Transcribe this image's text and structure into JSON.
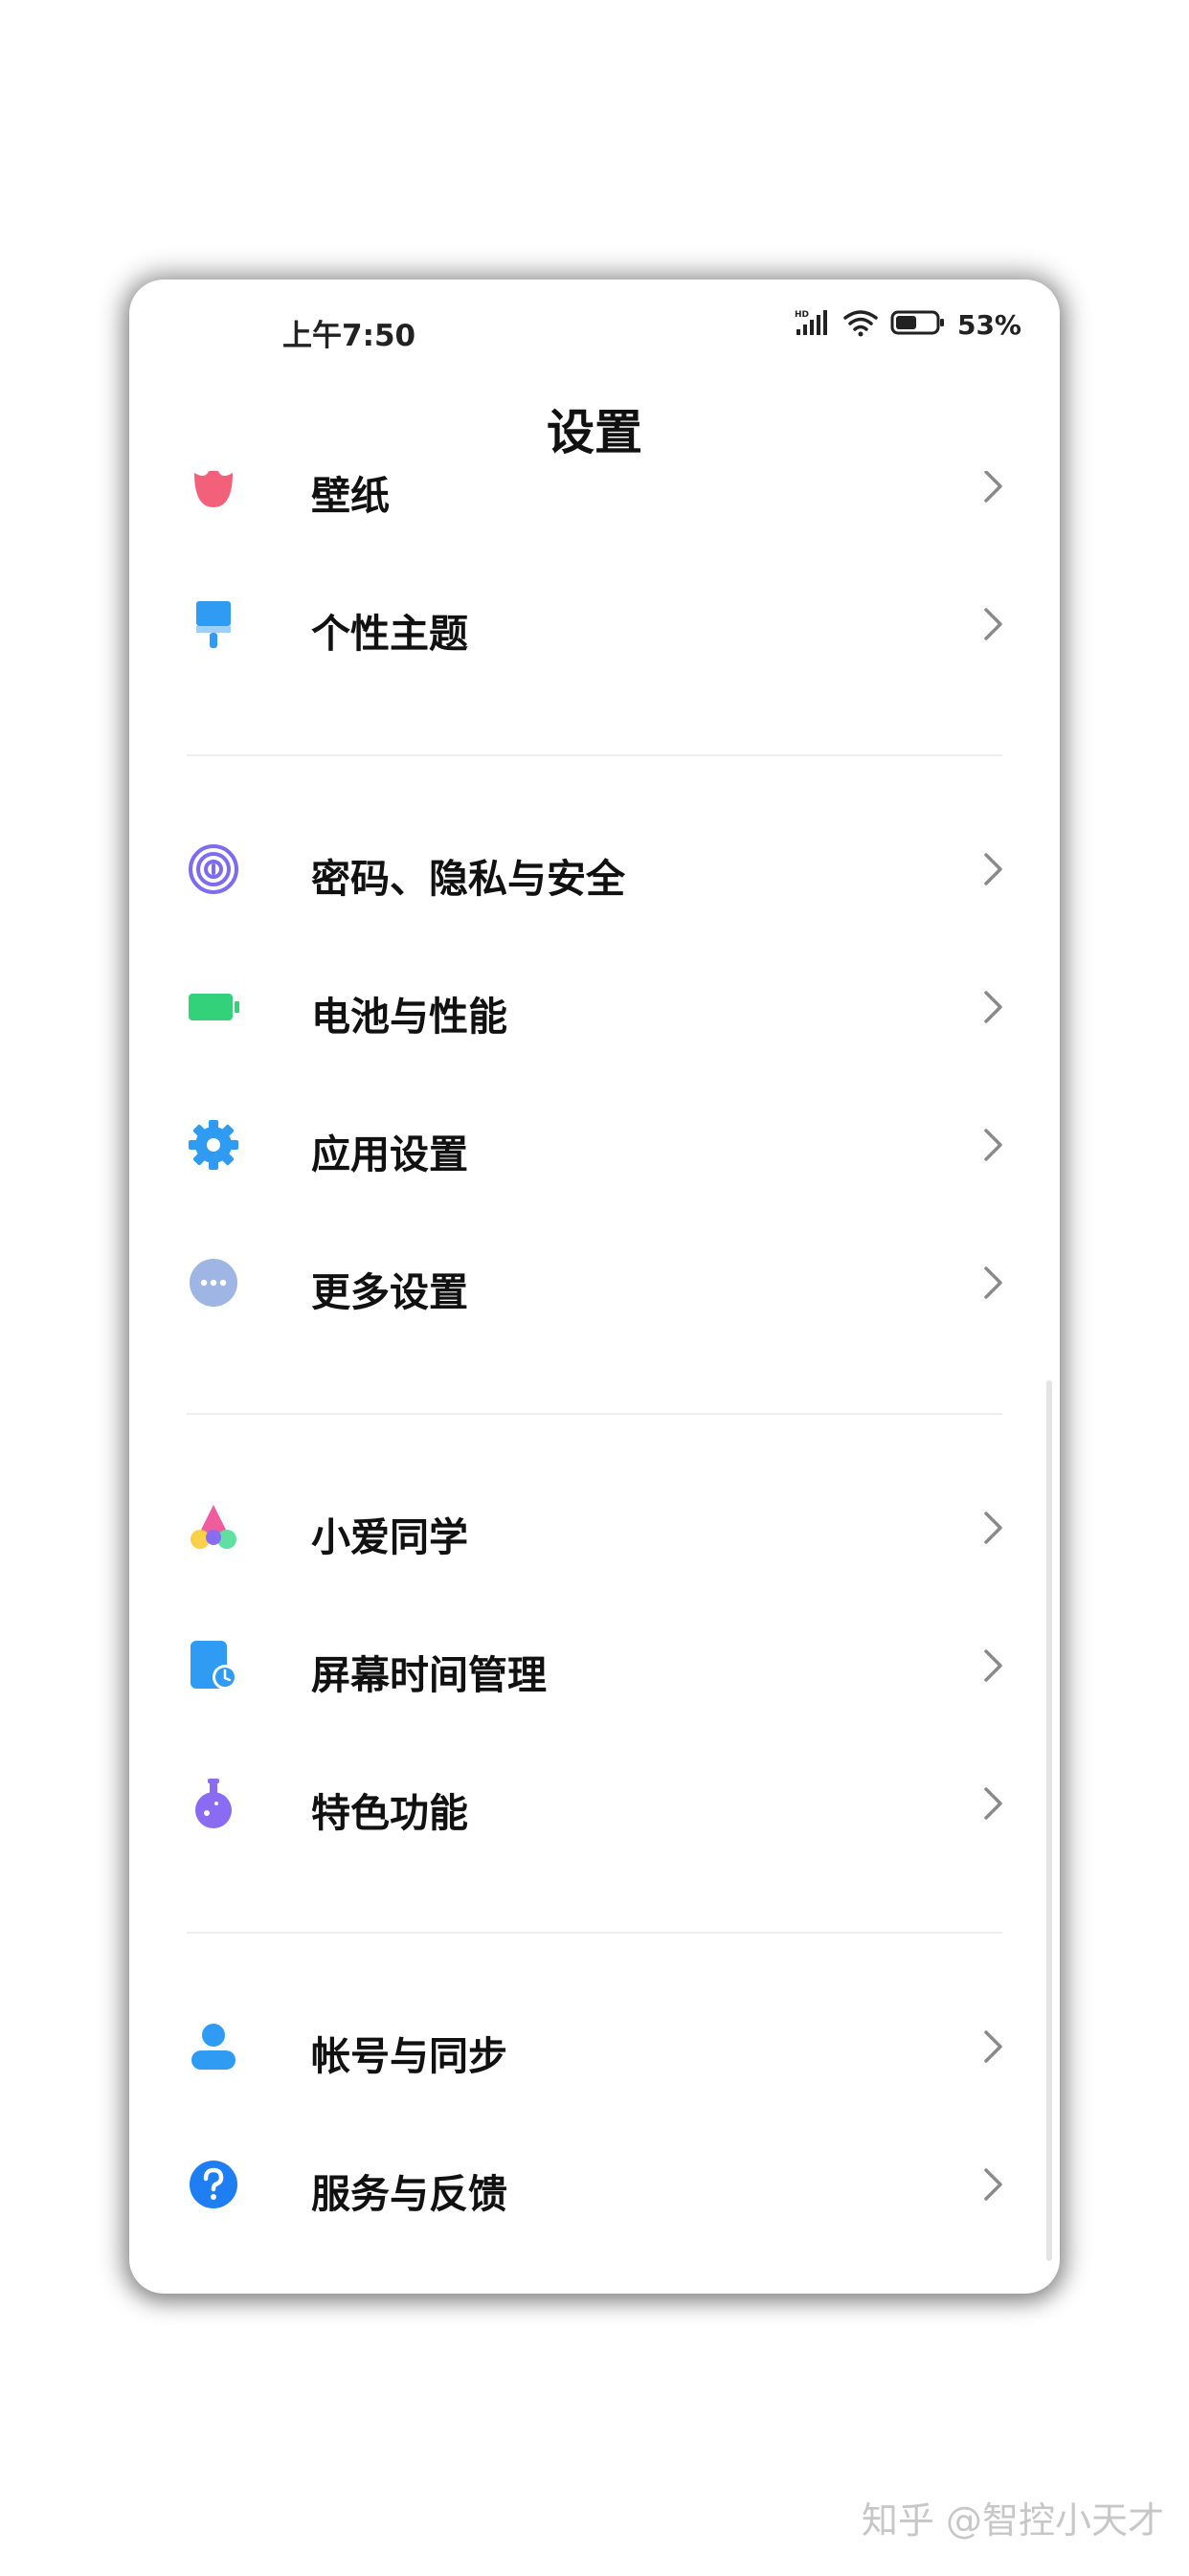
{
  "status_bar": {
    "time": "上午7:50",
    "network_badge": "HD",
    "battery_percent": "53%",
    "battery_level": 0.53
  },
  "header": {
    "title": "设置"
  },
  "settings": {
    "groups": [
      {
        "items": [
          {
            "label": "壁纸",
            "icon": "wallpaper-icon",
            "color": "#f2607a"
          },
          {
            "label": "个性主题",
            "icon": "theme-brush-icon",
            "color": "#2f9bf2"
          }
        ]
      },
      {
        "items": [
          {
            "label": "密码、隐私与安全",
            "icon": "fingerprint-icon",
            "color": "#7b6cf2"
          },
          {
            "label": "电池与性能",
            "icon": "battery-icon",
            "color": "#33d17a"
          },
          {
            "label": "应用设置",
            "icon": "gear-icon",
            "color": "#2f9bf2"
          },
          {
            "label": "更多设置",
            "icon": "more-dots-icon",
            "color": "#9fb6e4"
          }
        ]
      },
      {
        "items": [
          {
            "label": "小爱同学",
            "icon": "xiaoai-icon",
            "color": "#f05d9c"
          },
          {
            "label": "屏幕时间管理",
            "icon": "screen-time-icon",
            "color": "#2f9bf2"
          },
          {
            "label": "特色功能",
            "icon": "flask-icon",
            "color": "#8a6cf2"
          }
        ]
      },
      {
        "items": [
          {
            "label": "帐号与同步",
            "icon": "account-icon",
            "color": "#2f9bf2"
          },
          {
            "label": "服务与反馈",
            "icon": "help-icon",
            "color": "#1e7ef2"
          }
        ]
      }
    ]
  },
  "watermark": "知乎 @智控小天才"
}
